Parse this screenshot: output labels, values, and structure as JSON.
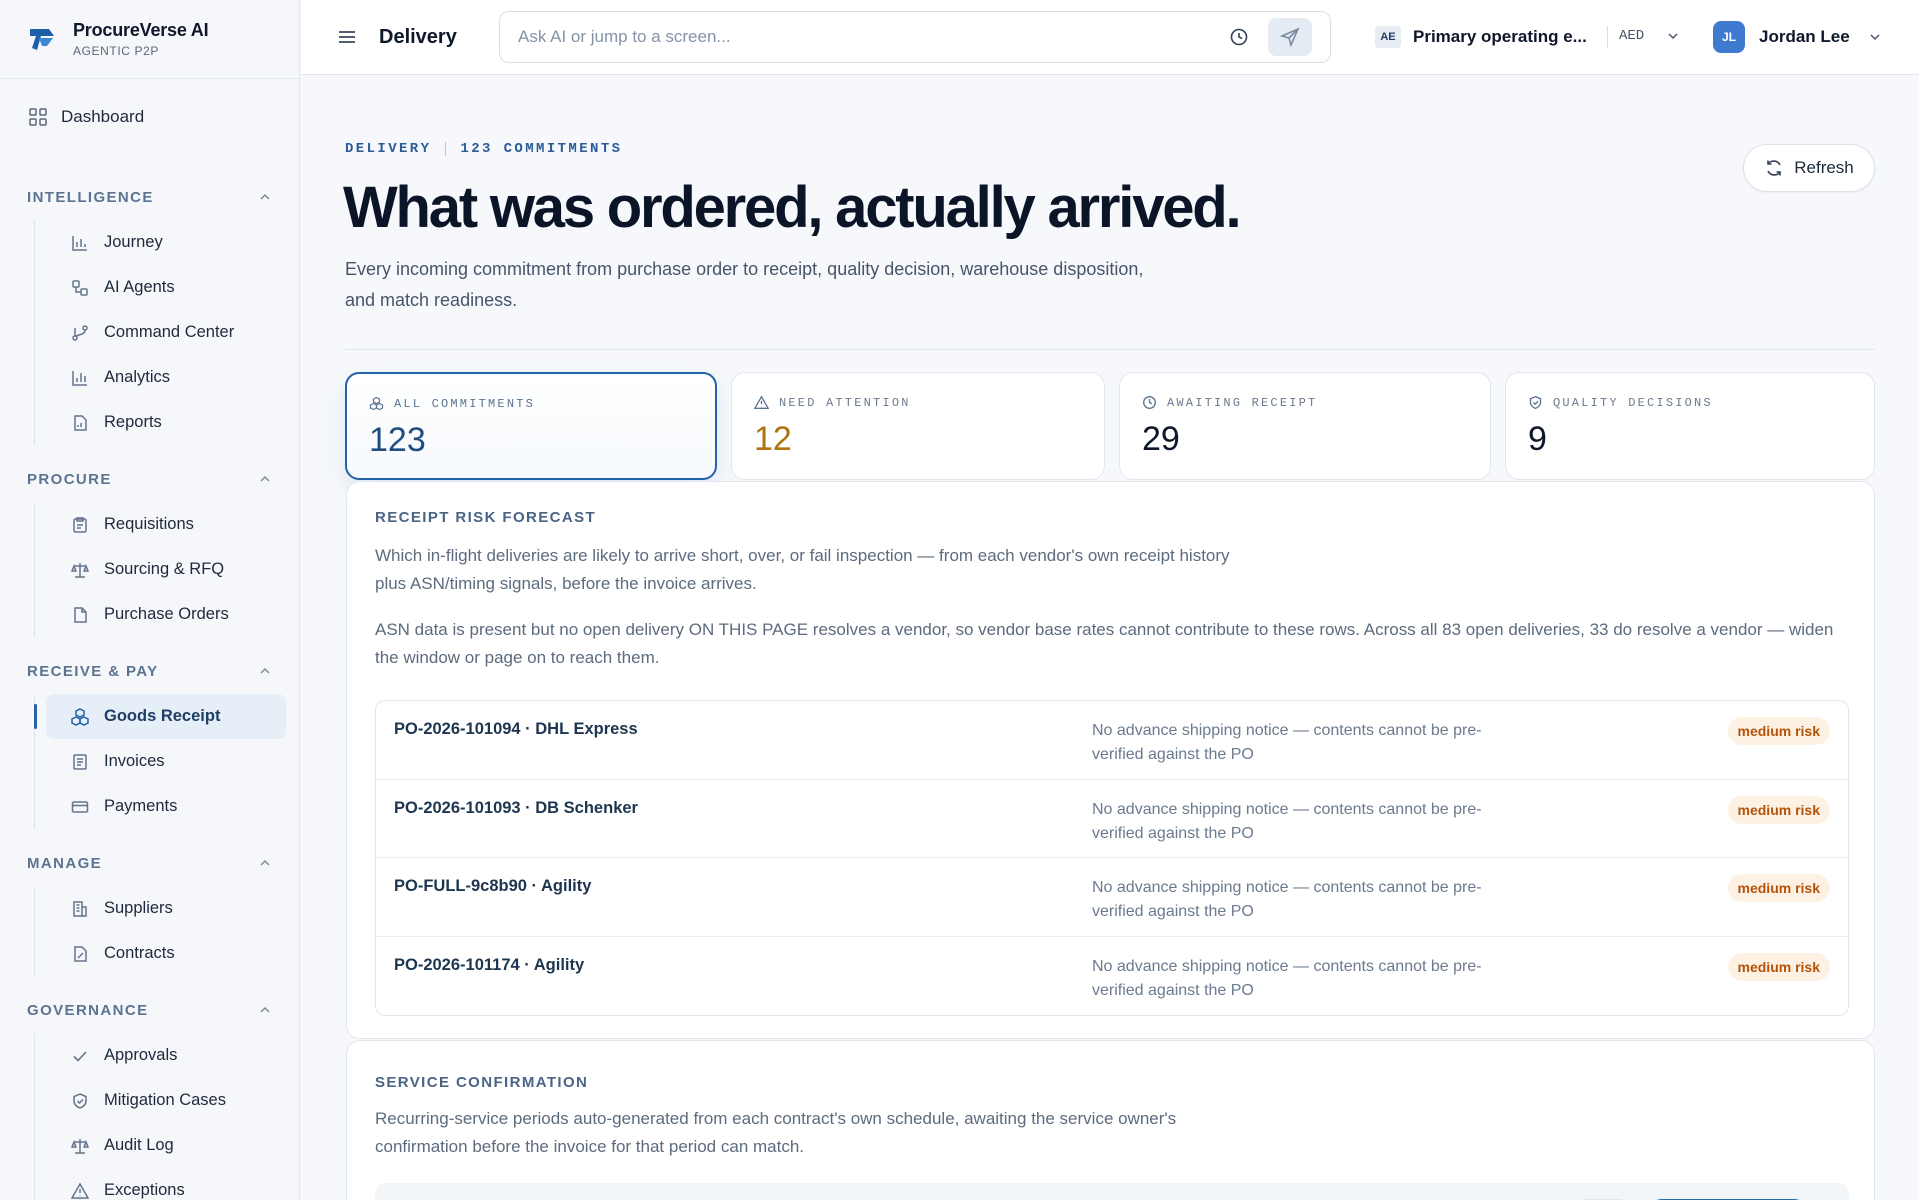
{
  "brand": {
    "name": "ProcureVerse AI",
    "tagline": "AGENTIC P2P"
  },
  "sidebar": {
    "dashboard": "Dashboard",
    "sections": [
      {
        "title": "INTELLIGENCE",
        "items": [
          "Journey",
          "AI Agents",
          "Command Center",
          "Analytics",
          "Reports"
        ]
      },
      {
        "title": "PROCURE",
        "items": [
          "Requisitions",
          "Sourcing & RFQ",
          "Purchase Orders"
        ]
      },
      {
        "title": "RECEIVE & PAY",
        "items": [
          "Goods Receipt",
          "Invoices",
          "Payments"
        ]
      },
      {
        "title": "MANAGE",
        "items": [
          "Suppliers",
          "Contracts"
        ]
      },
      {
        "title": "GOVERNANCE",
        "items": [
          "Approvals",
          "Mitigation Cases",
          "Audit Log",
          "Exceptions"
        ]
      }
    ],
    "active": "Goods Receipt"
  },
  "topbar": {
    "page": "Delivery",
    "search_placeholder": "Ask AI or jump to a screen...",
    "entity_code": "AE",
    "entity_name": "Primary operating e...",
    "currency": "AED",
    "user_initials": "JL",
    "user_name": "Jordan Lee"
  },
  "hero": {
    "eyebrow_section": "DELIVERY",
    "eyebrow_count": "123 COMMITMENTS",
    "title": "What was ordered, actually arrived.",
    "description": "Every incoming commitment from purchase order to receipt, quality decision, warehouse disposition, and match readiness.",
    "refresh_label": "Refresh"
  },
  "stats": [
    {
      "label": "ALL COMMITMENTS",
      "value": "123",
      "icon": "boxes-icon"
    },
    {
      "label": "NEED ATTENTION",
      "value": "12",
      "icon": "warning-icon"
    },
    {
      "label": "AWAITING RECEIPT",
      "value": "29",
      "icon": "clock-icon"
    },
    {
      "label": "QUALITY DECISIONS",
      "value": "9",
      "icon": "shield-check-icon"
    }
  ],
  "risk_forecast": {
    "title": "RECEIPT RISK FORECAST",
    "description": "Which in-flight deliveries are likely to arrive short, over, or fail inspection — from each vendor's own receipt history plus ASN/timing signals, before the invoice arrives.",
    "note": "ASN data is present but no open delivery ON THIS PAGE resolves a vendor, so vendor base rates cannot contribute to these rows. Across all 83 open deliveries, 33 do resolve a vendor — widen the window or page on to reach them.",
    "rows": [
      {
        "po": "PO-2026-101094 · DHL Express",
        "reason": "No advance shipping notice — contents cannot be pre-verified against the PO",
        "risk": "medium risk"
      },
      {
        "po": "PO-2026-101093 · DB Schenker",
        "reason": "No advance shipping notice — contents cannot be pre-verified against the PO",
        "risk": "medium risk"
      },
      {
        "po": "PO-FULL-9c8b90 · Agility",
        "reason": "No advance shipping notice — contents cannot be pre-verified against the PO",
        "risk": "medium risk"
      },
      {
        "po": "PO-2026-101174 · Agility",
        "reason": "No advance shipping notice — contents cannot be pre-verified against the PO",
        "risk": "medium risk"
      }
    ]
  },
  "service_confirmation": {
    "title": "SERVICE CONFIRMATION",
    "description": "Recurring-service periods auto-generated from each contract's own schedule, awaiting the service owner's confirmation before the invoice for that period can match."
  },
  "colors": {
    "accent": "#2563a8",
    "attention": "#b07310",
    "risk_badge_bg": "#fdf1e3",
    "risk_badge_text": "#b45309"
  }
}
